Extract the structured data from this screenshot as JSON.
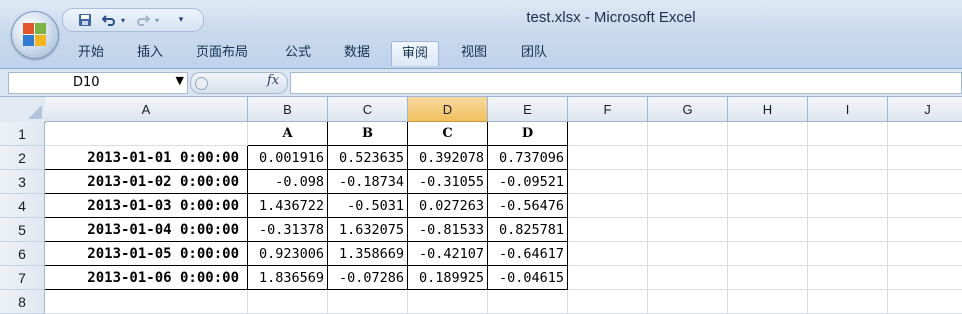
{
  "window": {
    "title": "test.xlsx - Microsoft Excel"
  },
  "quick_access": {
    "save_icon": "save-icon",
    "undo_icon": "undo-icon",
    "redo_icon": "redo-icon",
    "customize_icon": "customize-qat-icon"
  },
  "ribbon": {
    "tabs": [
      "开始",
      "插入",
      "页面布局",
      "公式",
      "数据",
      "审阅",
      "视图",
      "团队"
    ],
    "active_tab": "审阅"
  },
  "formula_bar": {
    "name_box": "D10",
    "fx_label": "fx",
    "formula": ""
  },
  "sheet": {
    "columns": [
      "A",
      "B",
      "C",
      "D",
      "E",
      "F",
      "G",
      "H",
      "I",
      "J"
    ],
    "selected_column": "D",
    "rows": [
      "1",
      "2",
      "3",
      "4",
      "5",
      "6",
      "7",
      "8"
    ],
    "header_row": [
      "",
      "A",
      "B",
      "C",
      "D"
    ],
    "data": [
      [
        "2013-01-01  0:00:00",
        "0.001916",
        "0.523635",
        "0.392078",
        "0.737096"
      ],
      [
        "2013-01-02  0:00:00",
        "-0.098",
        "-0.18734",
        "-0.31055",
        "-0.09521"
      ],
      [
        "2013-01-03  0:00:00",
        "1.436722",
        "-0.5031",
        "0.027263",
        "-0.56476"
      ],
      [
        "2013-01-04  0:00:00",
        "-0.31378",
        "1.632075",
        "-0.81533",
        "0.825781"
      ],
      [
        "2013-01-05  0:00:00",
        "0.923006",
        "1.358669",
        "-0.42107",
        "-0.64617"
      ],
      [
        "2013-01-06  0:00:00",
        "1.836569",
        "-0.07286",
        "0.189925",
        "-0.04615"
      ]
    ]
  }
}
